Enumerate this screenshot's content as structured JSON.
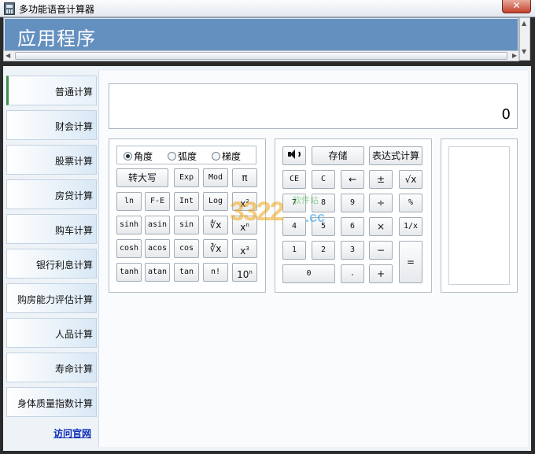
{
  "window": {
    "title": "多功能语音计算器",
    "close_glyph": "✕"
  },
  "banner": {
    "title": "应用程序"
  },
  "scrollbars": {
    "up": "▲",
    "down": "▼",
    "left": "◀",
    "right": "▶"
  },
  "sidebar": {
    "items": [
      {
        "label": "普通计算"
      },
      {
        "label": "财会计算"
      },
      {
        "label": "股票计算"
      },
      {
        "label": "房贷计算"
      },
      {
        "label": "购车计算"
      },
      {
        "label": "银行利息计算"
      },
      {
        "label": "购房能力评估计算"
      },
      {
        "label": "人品计算"
      },
      {
        "label": "寿命计算"
      },
      {
        "label": "身体质量指数计算"
      }
    ],
    "active_index": 0,
    "visit_link": "访问官网"
  },
  "display": {
    "value": "0"
  },
  "angle_mode": {
    "options": [
      "角度",
      "弧度",
      "梯度"
    ],
    "selected": "角度"
  },
  "sci_buttons": {
    "upper": "转大写",
    "exp": "Exp",
    "mod": "Mod",
    "pi": "π",
    "ln": "ln",
    "fe": "F-E",
    "int": "Int",
    "log": "Log",
    "x2_base": "x",
    "x2_exp": "2",
    "sinh": "sinh",
    "asin": "asin",
    "sin": "sin",
    "root_y": "∜x",
    "xn_base": "x",
    "xn_exp": "n",
    "cosh": "cosh",
    "acos": "acos",
    "cos": "cos",
    "cbrt": "∛x",
    "x3_base": "x",
    "x3_exp": "3",
    "tanh": "tanh",
    "atan": "atan",
    "tan": "tan",
    "fact": "n!",
    "ten_base": "10",
    "ten_exp": "n"
  },
  "std_buttons": {
    "store": "存储",
    "expr": "表达式计算",
    "ce": "CE",
    "c": "C",
    "back": "←",
    "pm": "±",
    "sqrt": "√x",
    "d7": "7",
    "d8": "8",
    "d9": "9",
    "div": "÷",
    "pct": "%",
    "d4": "4",
    "d5": "5",
    "d6": "6",
    "mul": "×",
    "recip": "1/x",
    "d1": "1",
    "d2": "2",
    "d3": "3",
    "sub": "−",
    "eq": "=",
    "d0": "0",
    "dot": ".",
    "add": "+"
  },
  "icons": {
    "speaker": "speaker-icon",
    "app": "calculator-icon"
  },
  "watermark": {
    "num": "3322",
    "cc": ".cc",
    "cn": "软件站"
  },
  "colors": {
    "banner": "#6490c0",
    "close": "#c4412c",
    "link": "#0a2cb8",
    "active_marker": "#3a8e49"
  }
}
